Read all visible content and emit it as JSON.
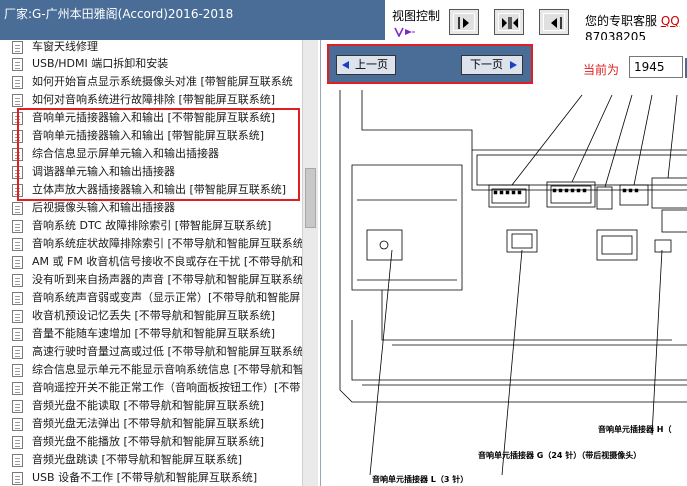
{
  "header": {
    "title": "厂家:G-广州本田雅阁(Accord)2016-2018",
    "view_control": "视图控制",
    "service_label": "您的专职客服 ",
    "service_link": "QQ",
    "phone": "87038205"
  },
  "list": {
    "items": [
      "车窗天线修理",
      "USB/HDMI 端口拆卸和安装",
      "如何开始盲点显示系统摄像头对准 [带智能屏互联系统",
      "如何对音响系统进行故障排除 [带智能屏互联系统]",
      "音响单元插接器输入和输出 [不带智能屏互联系统]",
      "音响单元插接器输入和输出 [带智能屏互联系统]",
      "综合信息显示屏单元输入和输出插接器",
      "调谐器单元输入和输出插接器",
      "立体声放大器插接器输入和输出 [带智能屏互联系统]",
      "后视摄像头输入和输出插接器",
      "音响系统 DTC 故障排除索引 [带智能屏互联系统]",
      "音响系统症状故障排除索引 [不带导航和智能屏互联系统",
      "AM 或 FM 收音机信号接收不良或存在干扰 [不带导航和",
      "没有听到来自扬声器的声音 [不带导航和智能屏互联系统",
      "音响系统声音弱或变声（显示正常）[不带导航和智能屏",
      "收音机预设记忆丢失 [不带导航和智能屏互联系统]",
      "音量不能随车速增加 [不带导航和智能屏互联系统]",
      "高速行驶时音量过高或过低 [不带导航和智能屏互联系统",
      "综合信息显示单元不能显示音响系统信息 [不带导航和智",
      "音响遥控开关不能正常工作（音响面板按钮工作）[不带",
      "音频光盘不能读取 [不带导航和智能屏互联系统]",
      "音频光盘无法弹出 [不带导航和智能屏互联系统]",
      "音频光盘不能播放 [不带导航和智能屏互联系统]",
      "音频光盘跳读 [不带导航和智能屏互联系统]",
      "USB 设备不工作 [不带导航和智能屏互联系统]"
    ]
  },
  "page_nav": {
    "prev_label": "上一页",
    "next_label": "下一页",
    "current_label": "当前为",
    "current_page": "1945"
  },
  "diagram": {
    "label_h": "音响单元插接器 H（",
    "label_g": "音响单元插接器 G（24 针）（带后视摄像头）",
    "label_l": "音响单元插接器 L（3 针）"
  },
  "colors": {
    "header_bg": "#4a6d98",
    "highlight": "#e02020",
    "arrow": "#1a3fc0"
  }
}
